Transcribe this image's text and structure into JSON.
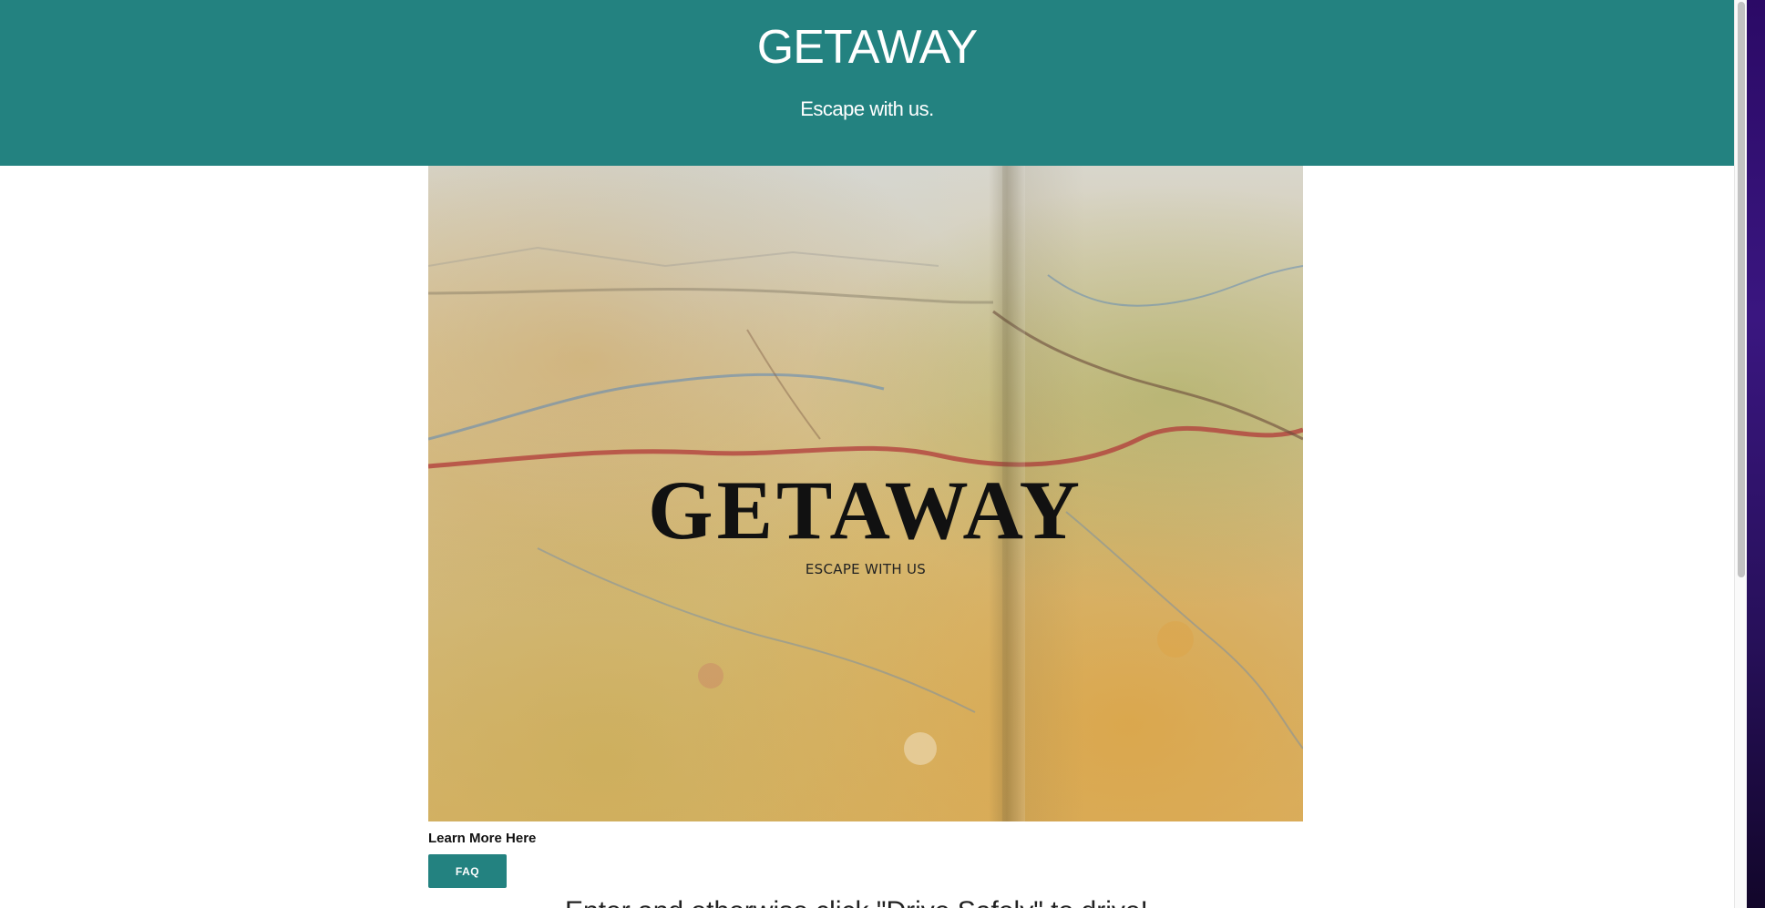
{
  "header": {
    "title": "GETAWAY",
    "tagline": "Escape with us."
  },
  "hero": {
    "title": "GETAWAY",
    "subtitle": "ESCAPE WITH US"
  },
  "learn_more": {
    "label": "Learn More Here",
    "button_label": "FAQ"
  },
  "partial_text": "Enter and otherwise click \"Drive Safely\" to drive!",
  "colors": {
    "brand": "#238280"
  }
}
